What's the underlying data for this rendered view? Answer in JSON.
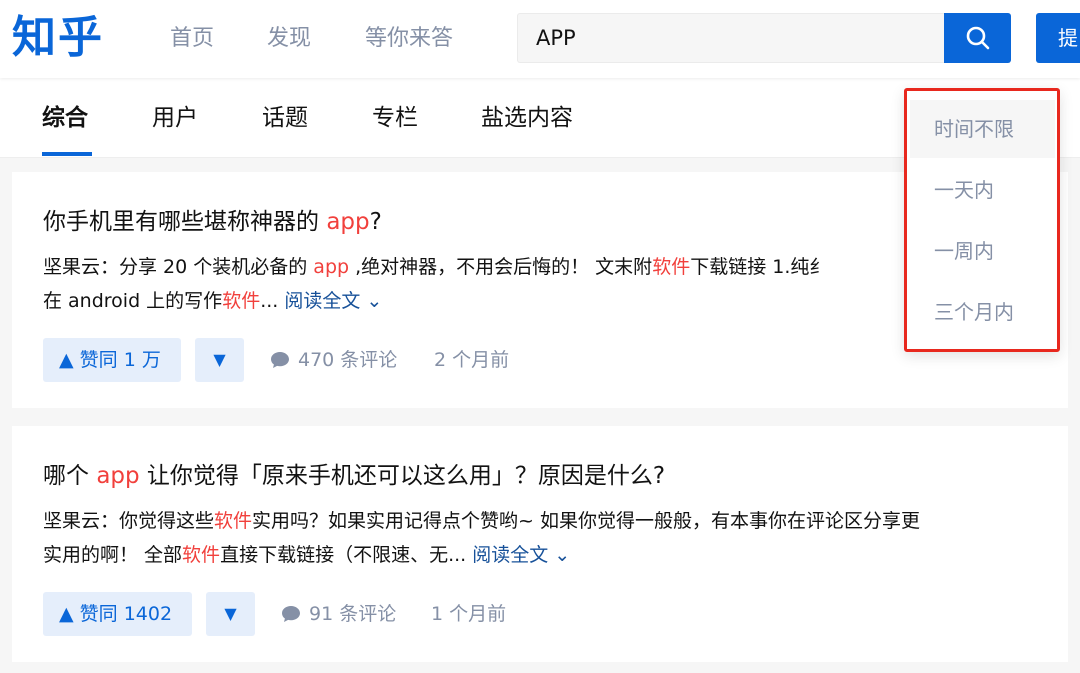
{
  "header": {
    "logo": "知乎",
    "nav": [
      "首页",
      "发现",
      "等你来答"
    ],
    "search_value": "APP",
    "ask_label": "提"
  },
  "tabs": [
    "综合",
    "用户",
    "话题",
    "专栏",
    "盐选内容"
  ],
  "results": [
    {
      "title_pre": "你手机里有哪些堪称神器的 ",
      "title_hl": "app",
      "title_post": "?",
      "line1_pre": "坚果云：分享 20 个装机必备的 ",
      "line1_hl1": "app",
      "line1_mid": " ,绝对神器，不用会后悔的！ 文末附",
      "line1_hl2": "软件",
      "line1_post": "下载链接 1.纯纟",
      "line2_pre": "在 android 上的写作",
      "line2_hl": "软件",
      "line2_post": "... ",
      "read_more": "阅读全文 ⌄",
      "vote_label": "▲ 赞同 1 万",
      "down_label": "▼",
      "comments": "470 条评论",
      "time": "2 个月前"
    },
    {
      "title_pre": "哪个 ",
      "title_hl": "app",
      "title_post": " 让你觉得「原来手机还可以这么用」？原因是什么?",
      "line1_pre": "坚果云：你觉得这些",
      "line1_hl": "软件",
      "line1_post": "实用吗？如果实用记得点个赞哟~ 如果你觉得一般般，有本事你在评论区分享更",
      "line2_pre": "实用的啊！ 全部",
      "line2_hl": "软件",
      "line2_post": "直接下载链接（不限速、无... ",
      "read_more": "阅读全文 ⌄",
      "vote_label": "▲ 赞同 1402",
      "down_label": "▼",
      "comments": "91 条评论",
      "time": "1 个月前"
    }
  ],
  "time_filter": [
    "时间不限",
    "一天内",
    "一周内",
    "三个月内"
  ],
  "colors": {
    "brand": "#0a66d8",
    "highlight": "#f1403c",
    "annotation_border": "#e8281e"
  }
}
